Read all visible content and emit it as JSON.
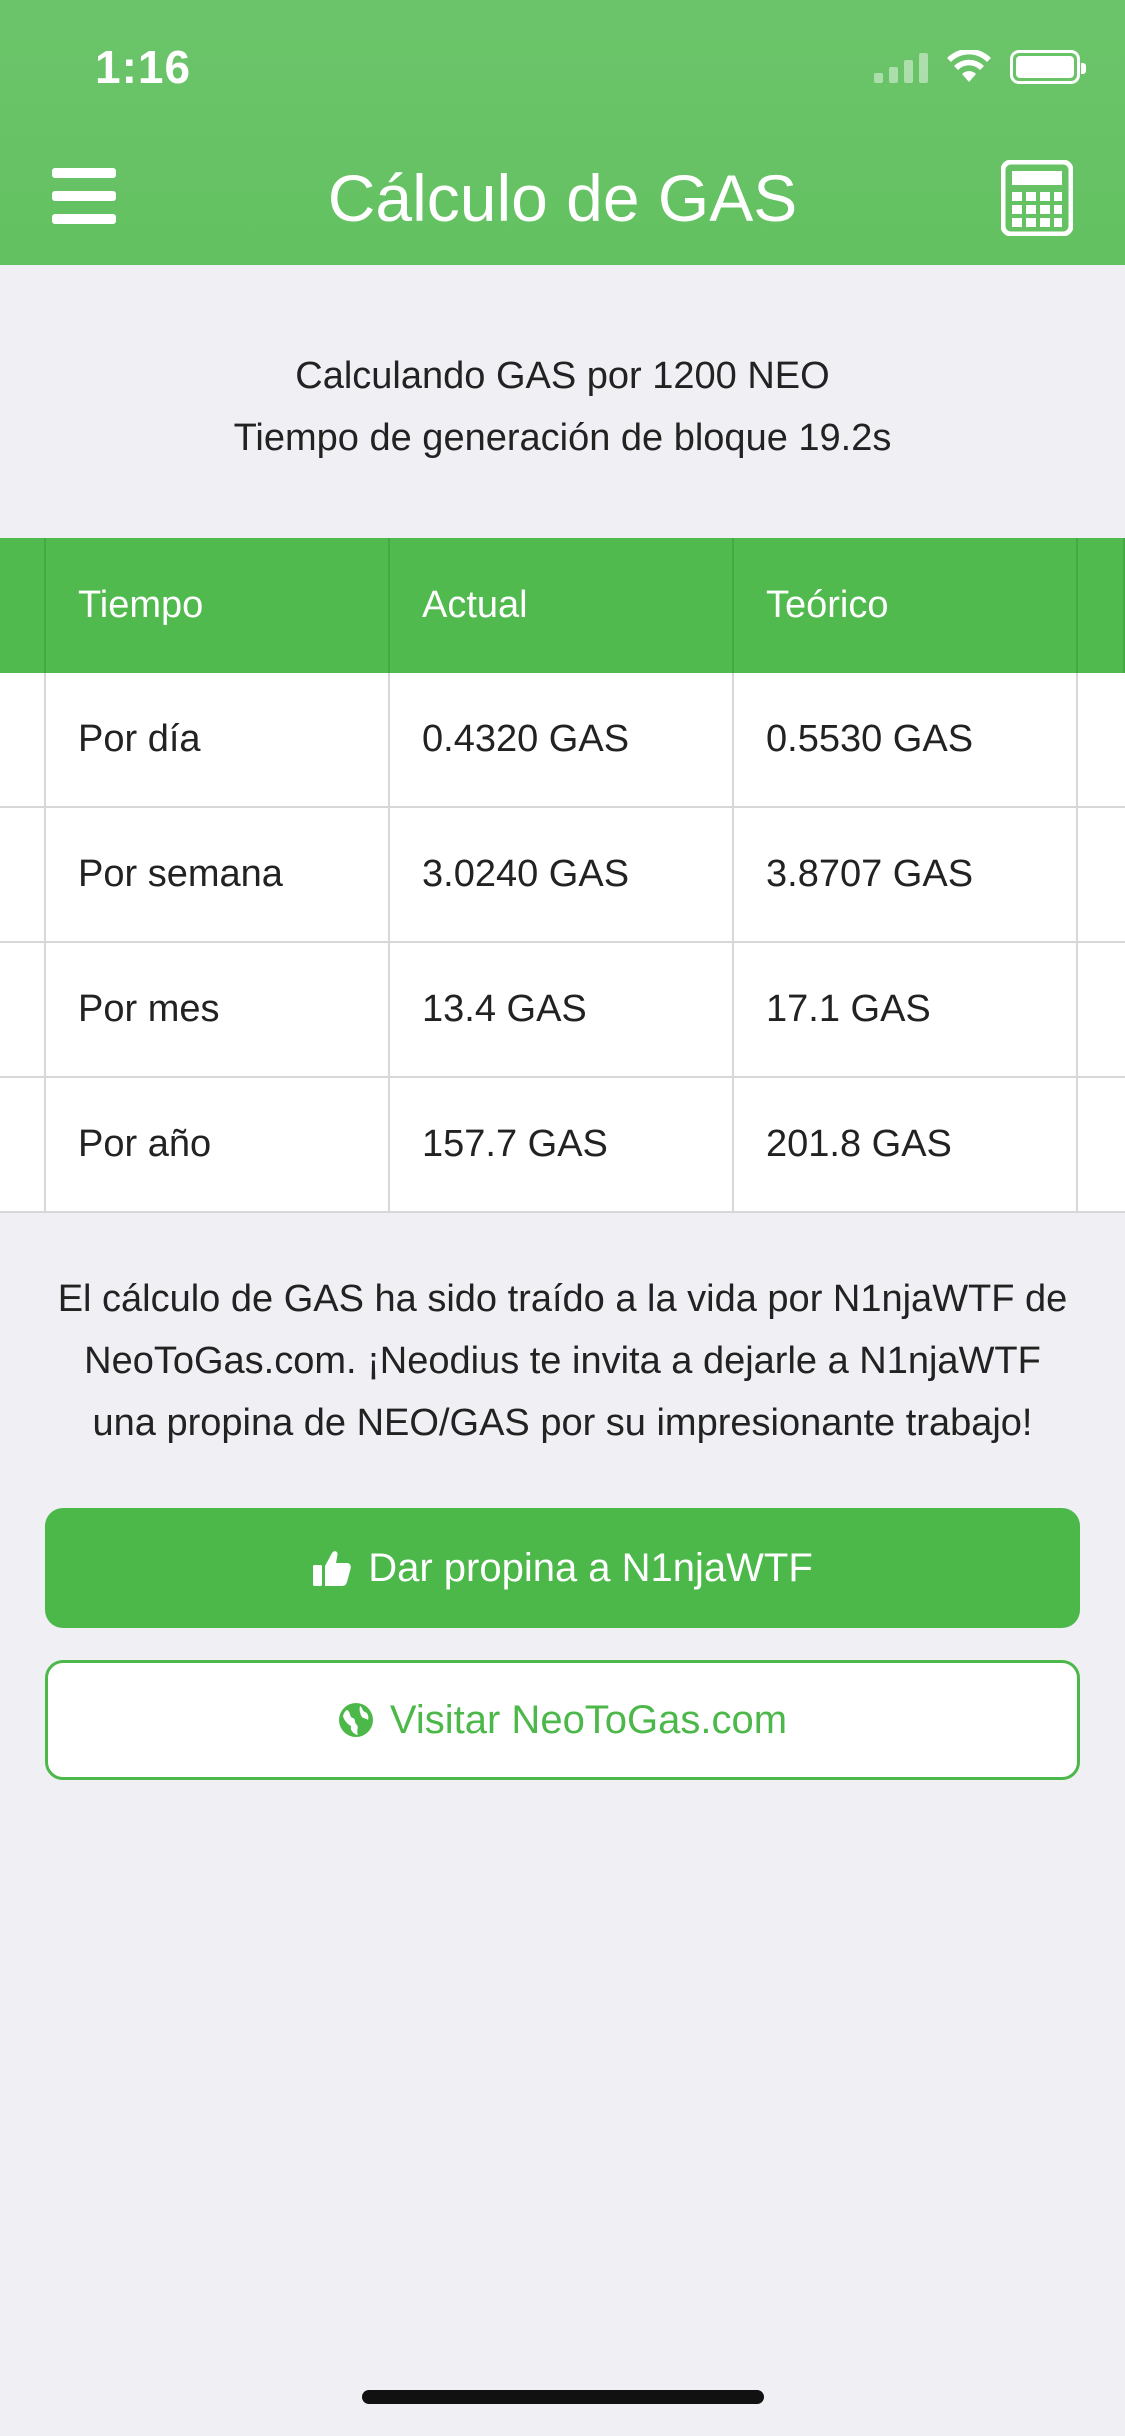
{
  "status_bar": {
    "time": "1:16"
  },
  "header": {
    "title": "Cálculo de GAS",
    "menu_icon": "hamburger-menu-icon",
    "calculator_icon": "calculator-icon"
  },
  "info": {
    "line1": "Calculando GAS por 1200 NEO",
    "line2": "Tiempo de generación de bloque 19.2s"
  },
  "table": {
    "headers": [
      "Tiempo",
      "Actual",
      "Teórico"
    ],
    "rows": [
      [
        "Por día",
        "0.4320 GAS",
        "0.5530 GAS"
      ],
      [
        "Por semana",
        "3.0240 GAS",
        "3.8707 GAS"
      ],
      [
        "Por mes",
        "13.4 GAS",
        "17.1 GAS"
      ],
      [
        "Por año",
        "157.7 GAS",
        "201.8 GAS"
      ]
    ]
  },
  "credit": {
    "line1": "El cálculo de GAS ha sido traído a la vida por N1njaWTF de",
    "line2": "NeoToGas.com. ¡Neodius te invita a dejarle a N1njaWTF",
    "line3": "una propina de NEO/GAS por su impresionante trabajo!"
  },
  "buttons": {
    "tip_label": "Dar propina a N1njaWTF",
    "tip_icon": "thumbs-up-icon",
    "visit_label": "Visitar NeoToGas.com",
    "visit_icon": "globe-icon"
  },
  "colors": {
    "brand_green": "#4cb849",
    "header_green": "#63c161",
    "background": "#efeff4"
  }
}
